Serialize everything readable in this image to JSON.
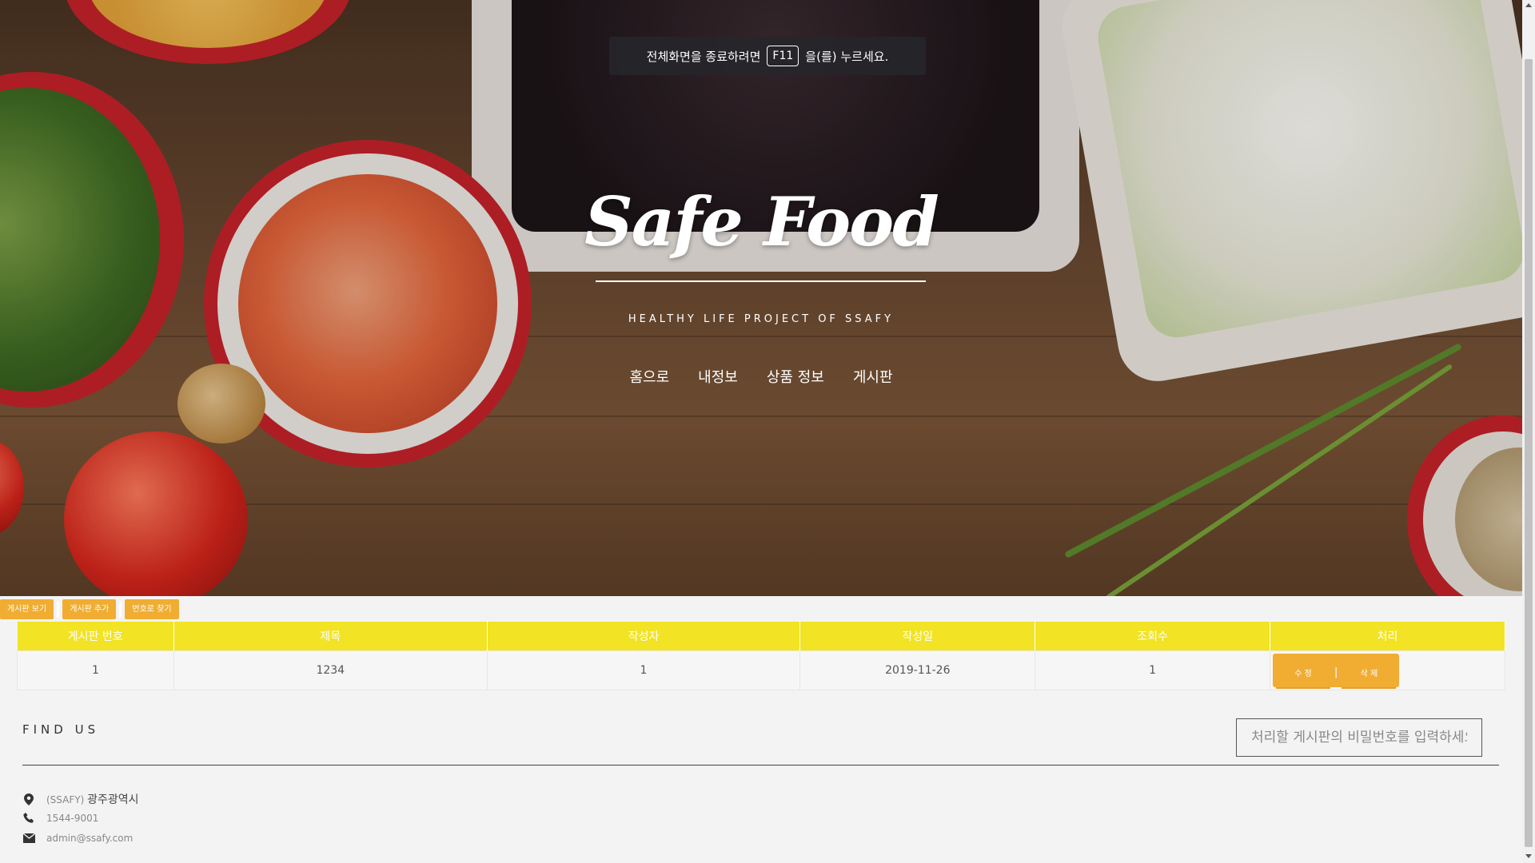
{
  "fullscreen_notice": {
    "before": "전체화면을 종료하려면",
    "key": "F11",
    "after": "을(를) 누르세요."
  },
  "hero": {
    "brand": "Safe Food",
    "tagline": "HEALTHY LIFE PROJECT OF SSAFY",
    "nav": [
      "홈으로",
      "내정보",
      "상품 정보",
      "게시판"
    ]
  },
  "toolbar": {
    "view": "게시판 보기",
    "add": "게시판 추가",
    "find_by_number": "번호로 찾기"
  },
  "table": {
    "headers": [
      "게시판 번호",
      "제목",
      "작성자",
      "작성일",
      "조회수",
      "처리"
    ],
    "rows": [
      {
        "no": "1",
        "title": "1234",
        "author": "1",
        "date": "2019-11-26",
        "views": "1",
        "edit": "수 정",
        "sep": "|",
        "delete": "삭 제"
      }
    ]
  },
  "footer": {
    "find_us": "FIND US",
    "password_placeholder": "처리할 게시판의 비밀번호를 입력하세요",
    "address_prefix": "(SSAFY)",
    "address": "광주광역시",
    "phone": "1544-9001",
    "email": "admin@ssafy.com"
  },
  "colors": {
    "header_yellow": "#f2e324",
    "button_orange": "#f0ad32"
  },
  "icons": [
    "map-marker-icon",
    "phone-icon",
    "envelope-icon"
  ]
}
